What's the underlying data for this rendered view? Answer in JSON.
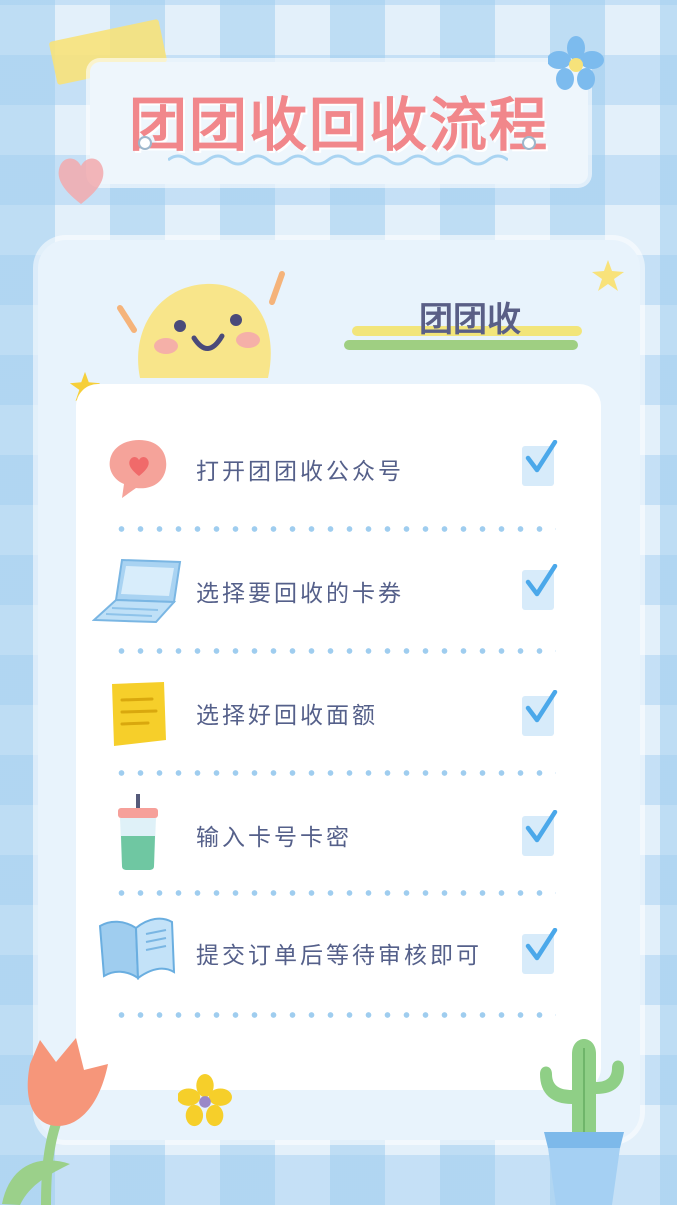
{
  "title": "团团收回收流程",
  "brand": "团团收",
  "steps": [
    {
      "label": "打开团团收公众号",
      "icon": "heart-bubble-icon",
      "checked": true
    },
    {
      "label": "选择要回收的卡券",
      "icon": "laptop-icon",
      "checked": true
    },
    {
      "label": "选择好回收面额",
      "icon": "sticky-note-icon",
      "checked": true
    },
    {
      "label": "输入卡号卡密",
      "icon": "drink-cup-icon",
      "checked": true
    },
    {
      "label": "提交订单后等待审核即可",
      "icon": "open-book-icon",
      "checked": true
    }
  ],
  "colors": {
    "title": "#f1878b",
    "text": "#55608a",
    "check": "#4ba8ea",
    "dots": "#9fcdef",
    "background": "#e3f0fa"
  }
}
